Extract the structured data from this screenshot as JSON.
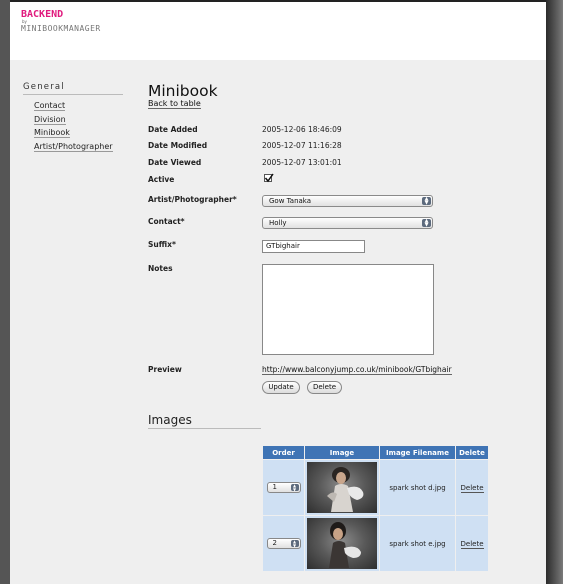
{
  "logo": {
    "backend": "BACKEND",
    "by": "by",
    "manager": "MINIBOOKMANAGER"
  },
  "sidebar": {
    "heading": "General",
    "items": [
      {
        "label": "Contact"
      },
      {
        "label": "Division"
      },
      {
        "label": "Minibook"
      },
      {
        "label": "Artist/Photographer"
      }
    ]
  },
  "main": {
    "title": "Minibook",
    "back_link": "Back to table",
    "fields": {
      "date_added": {
        "label": "Date Added",
        "value": "2005-12-06 18:46:09"
      },
      "date_modified": {
        "label": "Date Modified",
        "value": "2005-12-07 11:16:28"
      },
      "date_viewed": {
        "label": "Date Viewed",
        "value": "2005-12-07 13:01:01"
      },
      "active": {
        "label": "Active",
        "checked": true
      },
      "artist": {
        "label": "Artist/Photographer*",
        "value": "Gow Tanaka"
      },
      "contact": {
        "label": "Contact*",
        "value": "Holly"
      },
      "suffix": {
        "label": "Suffix*",
        "value": "GTbighair"
      },
      "notes": {
        "label": "Notes",
        "value": ""
      },
      "preview": {
        "label": "Preview",
        "url": "http://www.balconyjump.co.uk/minibook/GTbighair"
      }
    },
    "buttons": {
      "update": "Update",
      "delete": "Delete"
    }
  },
  "images": {
    "title": "Images",
    "columns": [
      "Order",
      "Image",
      "Image Filename",
      "Delete"
    ],
    "rows": [
      {
        "order": "1",
        "filename": "spark shot d.jpg",
        "delete": "Delete"
      },
      {
        "order": "2",
        "filename": "spark shot e.jpg",
        "delete": "Delete"
      }
    ]
  },
  "colors": {
    "brand": "#e0197d",
    "table_header": "#3f74b5",
    "table_row": "#cfe0f3"
  }
}
